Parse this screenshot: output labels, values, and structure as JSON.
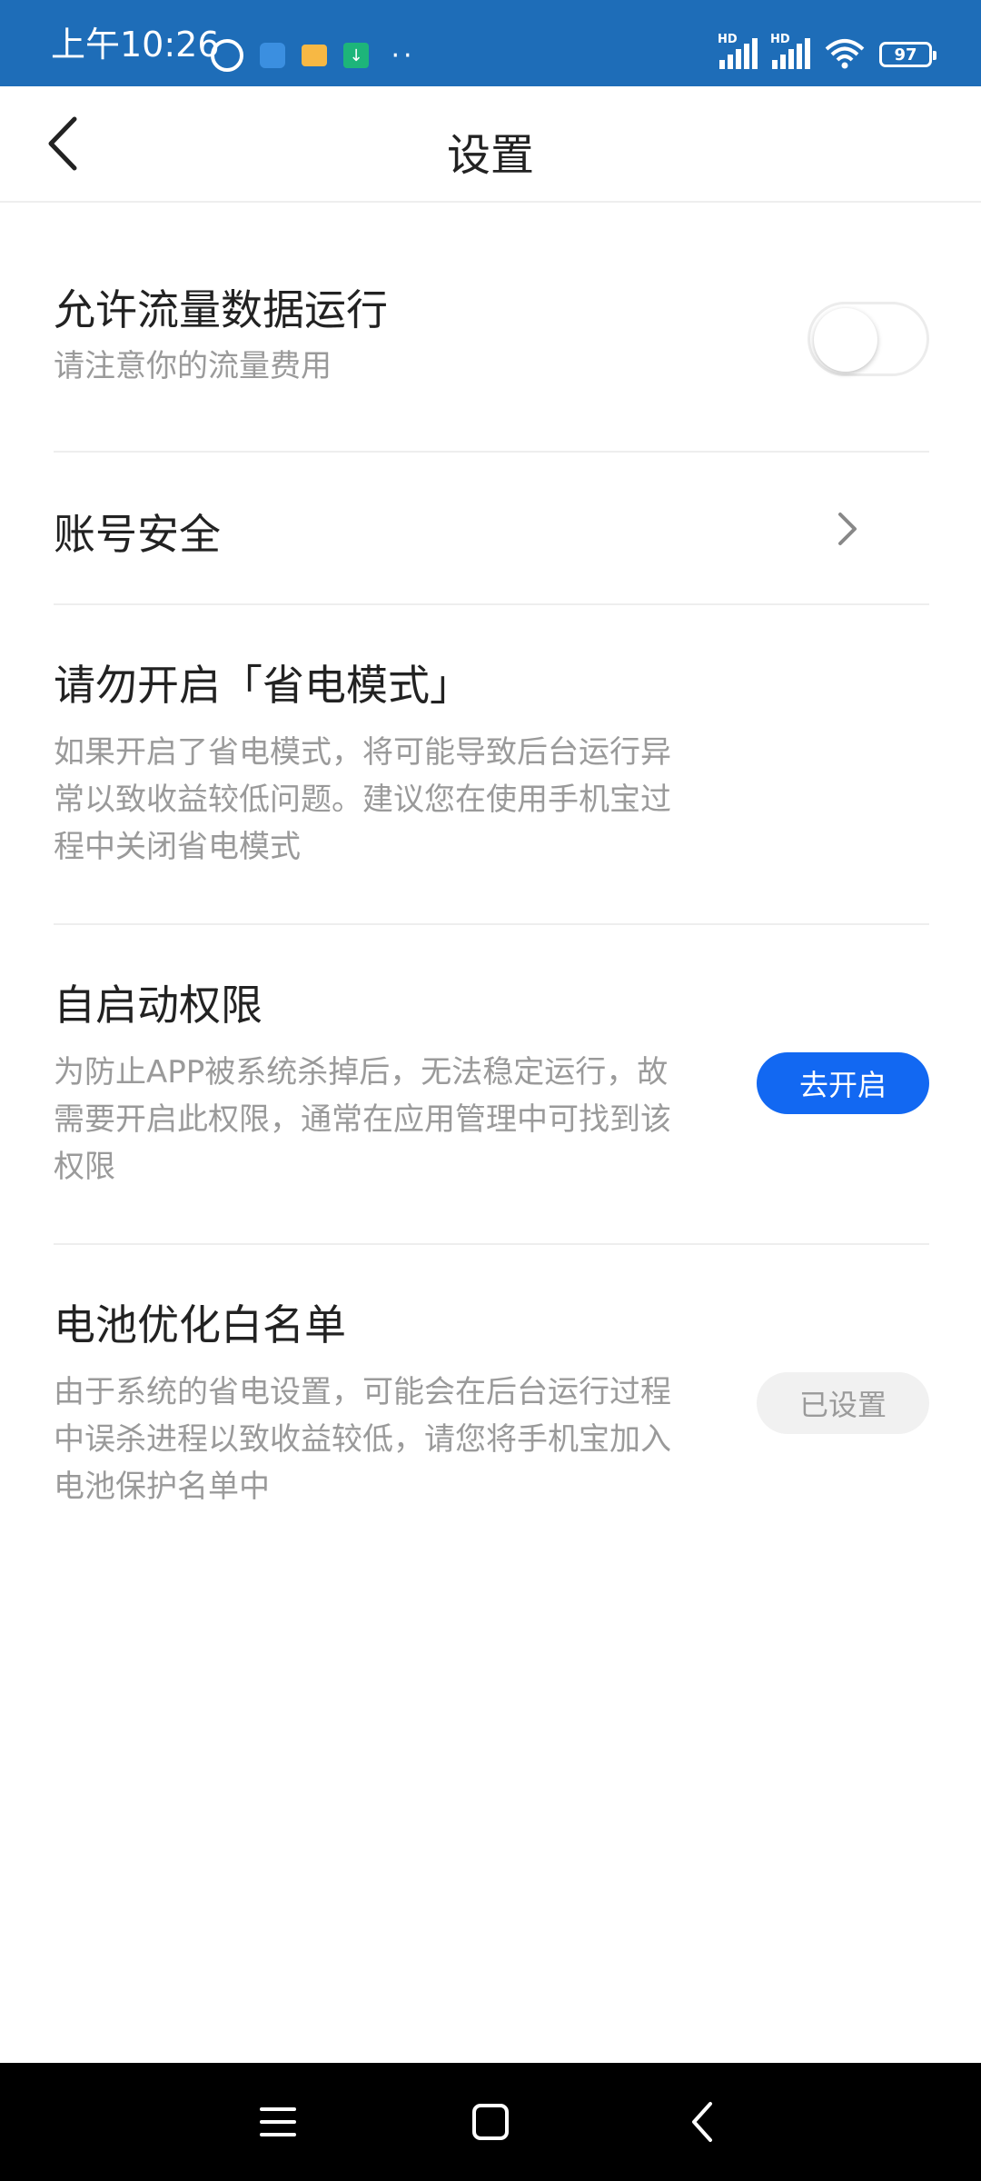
{
  "status_bar": {
    "time": "上午10:26",
    "battery_level": "97",
    "signal_1_label": "HD",
    "signal_2_label": "HD",
    "icons_left": [
      "alarm-icon",
      "app-notification-icon",
      "message-icon",
      "download-icon",
      "more-dots-icon"
    ],
    "icons_right": [
      "signal-icon",
      "signal-icon",
      "wifi-icon",
      "battery-icon"
    ]
  },
  "header": {
    "title": "设置",
    "back_icon": "chevron-left-icon"
  },
  "settings": {
    "mobile_data": {
      "title": "允许流量数据运行",
      "description": "请注意你的流量费用",
      "enabled": false
    },
    "account_security": {
      "title": "账号安全"
    },
    "power_saving": {
      "title": "请勿开启「省电模式」",
      "description": "如果开启了省电模式，将可能导致后台运行异常以致收益较低问题。建议您在使用手机宝过程中关闭省电模式"
    },
    "auto_start": {
      "title": "自启动权限",
      "description": "为防止APP被系统杀掉后，无法稳定运行，故需要开启此权限，通常在应用管理中可找到该权限",
      "button_label": "去开启"
    },
    "battery_whitelist": {
      "title": "电池优化白名单",
      "description": "由于系统的省电设置，可能会在后台运行过程中误杀进程以致收益较低，请您将手机宝加入电池保护名单中",
      "button_label": "已设置"
    }
  },
  "colors": {
    "status_bar": "#1e6db8",
    "primary_button": "#1268f2",
    "disabled_button": "#f1f1f1",
    "title_text": "#222222",
    "desc_text": "#9a9a9a"
  },
  "nav_bar": {
    "icons": [
      "menu-icon",
      "home-icon",
      "back-icon"
    ]
  }
}
